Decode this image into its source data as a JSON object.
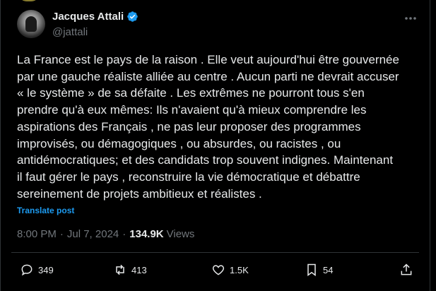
{
  "author": {
    "display_name": "Jacques Attali",
    "handle": "@jattali"
  },
  "tweet": {
    "text": "La France est le pays de la raison . Elle veut aujourd'hui être gouvernée\npar une  gauche réaliste alliée au centre .  Aucun  parti ne devrait accuser\n« le système »  de sa défaite . Les extrêmes  ne pourront  tous s'en\nprendre qu'à eux mêmes: Ils n'avaient qu'à  mieux comprendre les\naspirations des Français , ne pas leur proposer des programmes\nimprovisés,  ou démagogiques  , ou absurdes,  ou racistes , ou\nantidémocratiques; et des candidats trop souvent indignes.  Maintenant\nil faut gérer le pays , reconstruire la vie démocratique et débattre\nsereinement de projets ambitieux et réalistes .",
    "translate_label": "Translate post",
    "time": "8:00 PM",
    "date": "Jul 7, 2024",
    "views_count": "134.9K",
    "views_label": "Views"
  },
  "actions": {
    "replies": "349",
    "reposts": "413",
    "likes": "1.5K",
    "bookmarks": "54"
  },
  "colors": {
    "background": "#000000",
    "text": "#e7e9ea",
    "muted": "#71767b",
    "accent": "#1d9bf0",
    "verified": "#1d9bf0"
  },
  "icons": {
    "verified": "verified-badge-icon",
    "more": "more-dots-icon",
    "reply": "reply-icon",
    "repost": "repost-icon",
    "like": "heart-icon",
    "bookmark": "bookmark-icon",
    "share": "share-icon"
  }
}
